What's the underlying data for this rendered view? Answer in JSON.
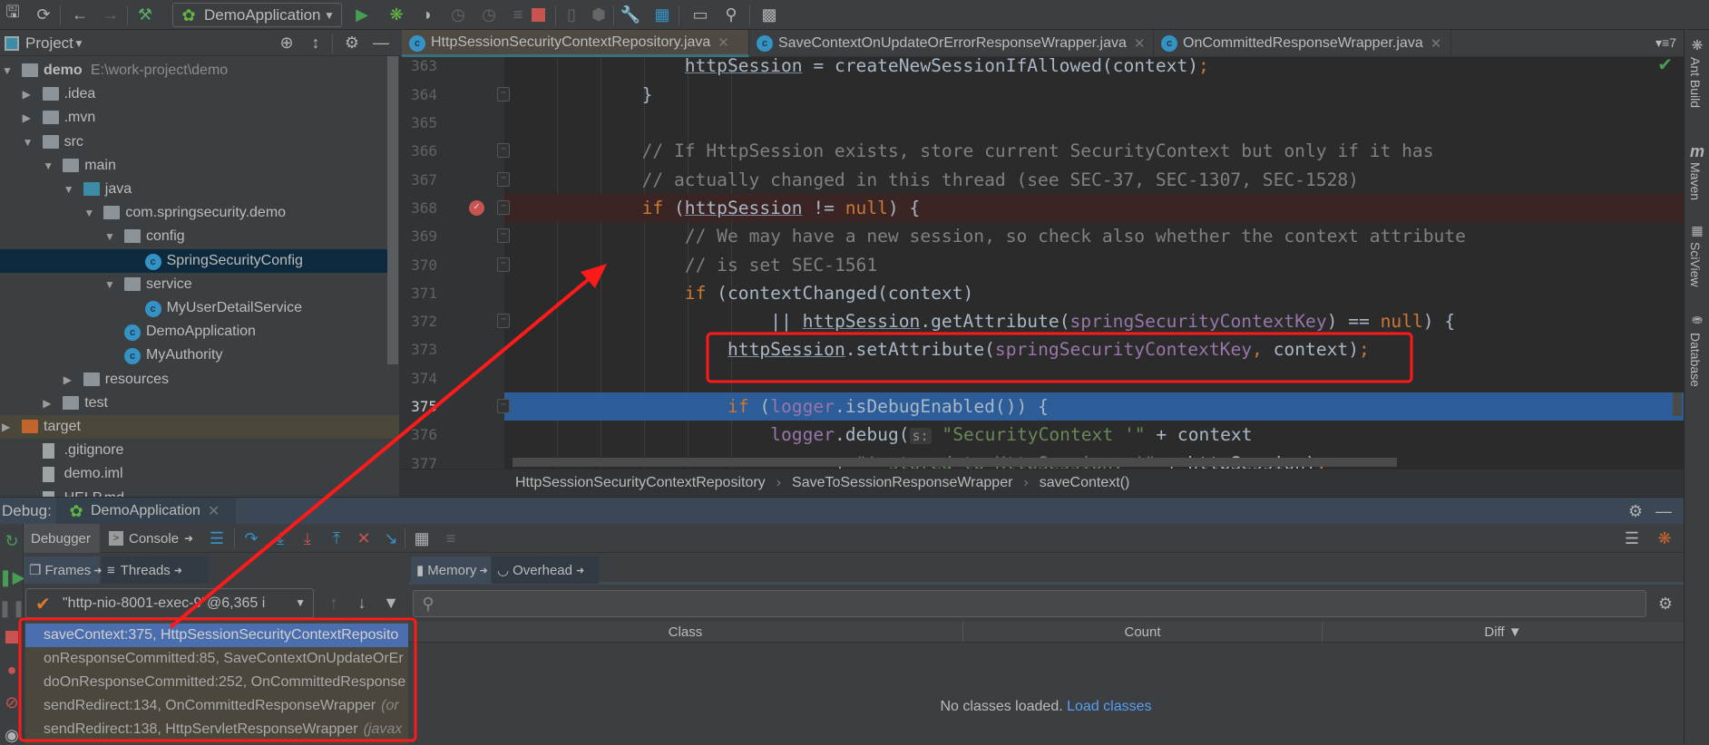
{
  "toolbar": {
    "run_config": "DemoApplication",
    "icons": [
      "save-icon",
      "sync-icon",
      "back-icon",
      "forward-icon",
      "build-hammer-icon",
      "run-icon",
      "debug-icon",
      "coverage-icon",
      "profile-icon",
      "profile-cpu-icon",
      "step-icon",
      "stop-icon",
      "device-icon",
      "sdk-icon",
      "settings-wrench-icon",
      "project-structure-icon",
      "terminal-icon",
      "search-icon",
      "vcs-icon"
    ]
  },
  "project": {
    "title": "Project",
    "tree": [
      {
        "label": "demo",
        "path": "E:\\work-project\\demo",
        "depth": 0,
        "type": "module",
        "expanded": true
      },
      {
        "label": ".idea",
        "depth": 1,
        "type": "folder",
        "expanded": false
      },
      {
        "label": ".mvn",
        "depth": 1,
        "type": "folder",
        "expanded": false
      },
      {
        "label": "src",
        "depth": 1,
        "type": "folder",
        "expanded": true
      },
      {
        "label": "main",
        "depth": 2,
        "type": "folder",
        "expanded": true
      },
      {
        "label": "java",
        "depth": 3,
        "type": "source-folder",
        "expanded": true
      },
      {
        "label": "com.springsecurity.demo",
        "depth": 4,
        "type": "package",
        "expanded": true
      },
      {
        "label": "config",
        "depth": 5,
        "type": "package",
        "expanded": true
      },
      {
        "label": "SpringSecurityConfig",
        "depth": 6,
        "type": "class",
        "selected": true
      },
      {
        "label": "service",
        "depth": 5,
        "type": "package",
        "expanded": true
      },
      {
        "label": "MyUserDetailService",
        "depth": 6,
        "type": "class"
      },
      {
        "label": "DemoApplication",
        "depth": 5,
        "type": "class"
      },
      {
        "label": "MyAuthority",
        "depth": 5,
        "type": "class"
      },
      {
        "label": "resources",
        "depth": 3,
        "type": "resources",
        "expanded": false
      },
      {
        "label": "test",
        "depth": 2,
        "type": "folder",
        "expanded": false
      },
      {
        "label": "target",
        "depth": 0,
        "type": "excluded-folder",
        "expanded": false
      },
      {
        "label": ".gitignore",
        "depth": 1,
        "type": "file"
      },
      {
        "label": "demo.iml",
        "depth": 1,
        "type": "file"
      },
      {
        "label": "HELP.md",
        "depth": 1,
        "type": "file"
      }
    ]
  },
  "editor": {
    "tabs": [
      {
        "label": "HttpSessionSecurityContextRepository.java",
        "active": true
      },
      {
        "label": "SaveContextOnUpdateOrErrorResponseWrapper.java",
        "active": false
      },
      {
        "label": "OnCommittedResponseWrapper.java",
        "active": false
      }
    ],
    "tab_count": "7",
    "breakpoint_line": 368,
    "current_line": 375,
    "lines": [
      {
        "n": "363",
        "indent": 16,
        "tokens": [
          [
            "httpSession",
            "ul"
          ],
          [
            " = createNewSessionIfAllowed(context)",
            "id"
          ],
          [
            ";",
            "kw"
          ]
        ]
      },
      {
        "n": "364",
        "indent": 12,
        "tokens": [
          [
            "}",
            "id"
          ]
        ]
      },
      {
        "n": "365",
        "indent": 0,
        "tokens": []
      },
      {
        "n": "366",
        "indent": 12,
        "tokens": [
          [
            "// If HttpSession exists, store current SecurityContext but only if it has",
            "cm"
          ]
        ]
      },
      {
        "n": "367",
        "indent": 12,
        "tokens": [
          [
            "// actually changed in this thread (see SEC-37, SEC-1307, SEC-1528)",
            "cm"
          ]
        ]
      },
      {
        "n": "368",
        "indent": 12,
        "tokens": [
          [
            "if",
            "kw"
          ],
          [
            " (",
            "id"
          ],
          [
            "httpSession",
            "ul"
          ],
          [
            " != ",
            "id"
          ],
          [
            "null",
            "kw"
          ],
          [
            ") {",
            "id"
          ]
        ]
      },
      {
        "n": "369",
        "indent": 16,
        "tokens": [
          [
            "// We may have a new session, so check also whether the context attribute",
            "cm"
          ]
        ]
      },
      {
        "n": "370",
        "indent": 16,
        "tokens": [
          [
            "// is set SEC-1561",
            "cm"
          ]
        ]
      },
      {
        "n": "371",
        "indent": 16,
        "tokens": [
          [
            "if",
            "kw"
          ],
          [
            " (contextChanged(context)",
            "id"
          ]
        ]
      },
      {
        "n": "372",
        "indent": 24,
        "tokens": [
          [
            "|| ",
            "id"
          ],
          [
            "httpSession",
            "ul"
          ],
          [
            ".getAttribute(",
            "id"
          ],
          [
            "springSecurityContextKey",
            "fd"
          ],
          [
            ") == ",
            "id"
          ],
          [
            "null",
            "kw"
          ],
          [
            ") {",
            "id"
          ]
        ]
      },
      {
        "n": "373",
        "indent": 20,
        "tokens": [
          [
            "httpSession",
            "ul"
          ],
          [
            ".setAttribute(",
            "id"
          ],
          [
            "springSecurityContextKey",
            "fd"
          ],
          [
            ", ",
            "kw"
          ],
          [
            "context)",
            "id"
          ],
          [
            ";",
            "kw"
          ]
        ]
      },
      {
        "n": "374",
        "indent": 0,
        "tokens": []
      },
      {
        "n": "375",
        "indent": 20,
        "tokens": [
          [
            "if",
            "kw"
          ],
          [
            " (",
            "id"
          ],
          [
            "logger",
            "fd"
          ],
          [
            ".isDebugEnabled()) {",
            "id"
          ]
        ]
      },
      {
        "n": "376",
        "indent": 24,
        "tokens": [
          [
            "logger",
            "fd"
          ],
          [
            ".debug(",
            "id"
          ],
          [
            "s:",
            "hint"
          ],
          [
            " ",
            "id"
          ],
          [
            "\"SecurityContext '\"",
            "st"
          ],
          [
            " + context",
            "id"
          ]
        ]
      },
      {
        "n": "377",
        "indent": 30,
        "tokens": [
          [
            "+ ",
            "id"
          ],
          [
            "\"' stored to HttpSession: '\"",
            "st"
          ],
          [
            " + httpSession)",
            "id"
          ],
          [
            ";",
            "kw"
          ]
        ]
      }
    ],
    "breadcrumbs": [
      "HttpSessionSecurityContextRepository",
      "SaveToSessionResponseWrapper",
      "saveContext()"
    ]
  },
  "right_sidebar": [
    "Ant Build",
    "Maven",
    "SciView",
    "Database"
  ],
  "debug": {
    "label": "Debug:",
    "session_tab": "DemoApplication",
    "tabs": [
      "Debugger",
      "Console"
    ],
    "frame_tabs": [
      "Frames",
      "Threads"
    ],
    "thread": "\"http-nio-8001-exec-9\"@6,365 i",
    "frames": [
      {
        "text": "saveContext:375, HttpSessionSecurityContextReposito",
        "pkg": "",
        "selected": true
      },
      {
        "text": "onResponseCommitted:85, SaveContextOnUpdateOrEr",
        "pkg": ""
      },
      {
        "text": "doOnResponseCommitted:252, OnCommittedResponse",
        "pkg": ""
      },
      {
        "text": "sendRedirect:134, OnCommittedResponseWrapper",
        "pkg": "(or"
      },
      {
        "text": "sendRedirect:138, HttpServletResponseWrapper",
        "pkg": "(javax"
      }
    ],
    "memory": {
      "tabs": [
        "Memory",
        "Overhead"
      ],
      "search_placeholder": "",
      "columns": [
        "Class",
        "Count",
        "Diff ▼"
      ],
      "empty_text": "No classes loaded.",
      "load_link": "Load classes"
    }
  },
  "colors": {
    "annotation": "#ff1a1a",
    "selection": "#4b6eaf",
    "current_line": "#2d5d98",
    "keyword": "#cc7832",
    "field": "#9876aa",
    "comment": "#808080",
    "string": "#6a8759"
  }
}
